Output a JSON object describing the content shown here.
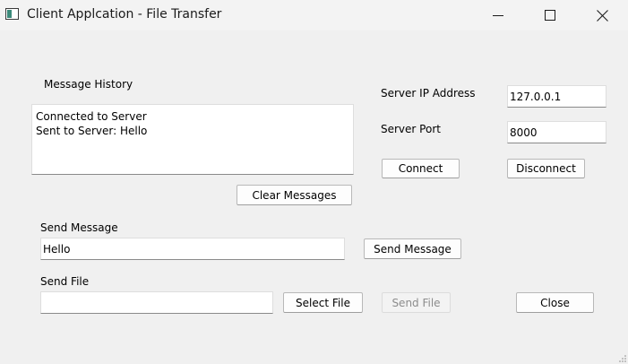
{
  "window": {
    "title": "Client Applcation - File Transfer",
    "minimize_icon": "minimize-icon",
    "maximize_icon": "maximize-icon",
    "close_icon": "close-icon"
  },
  "history": {
    "label": "Message History",
    "lines": [
      "Connected to Server",
      "Sent to Server: Hello"
    ],
    "clear_label": "Clear Messages"
  },
  "server": {
    "ip_label": "Server IP Address",
    "ip_value": "127.0.0.1",
    "port_label": "Server Port",
    "port_value": "8000",
    "connect_label": "Connect",
    "disconnect_label": "Disconnect"
  },
  "message": {
    "label": "Send Message",
    "value": "Hello",
    "send_label": "Send Message"
  },
  "file": {
    "label": "Send File",
    "value": "",
    "select_label": "Select File",
    "send_label": "Send File",
    "send_enabled": false
  },
  "close_label": "Close",
  "colors": {
    "background": "#f0f0f0",
    "field_background": "#ffffff",
    "disabled_text": "#8c8c8c"
  }
}
